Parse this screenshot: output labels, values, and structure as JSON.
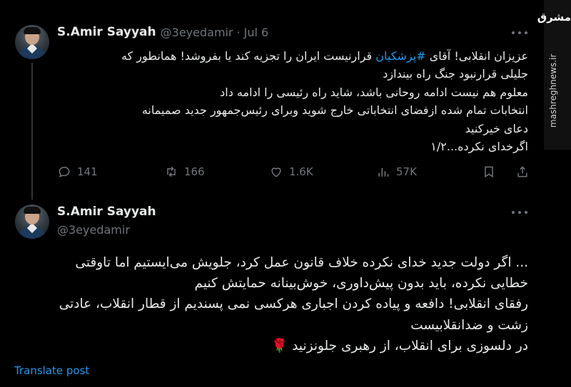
{
  "tweet1": {
    "name": "S.Amir Sayyah",
    "handle": "@3eyedamir",
    "dot": "·",
    "date": "Jul 6",
    "text_pre": "عزیزان انقلابی! آقای ",
    "hashtag": "#پزشکیان",
    "text_post": " قرارنیست ایران را تجزیه کند یا بفروشد! همانطور که",
    "lines": [
      "جلیلی قرارنبود جنگ راه بیندازد",
      "معلوم هم نیست ادامه روحانی باشد، شاید راه رئیسی را ادامه داد",
      "انتخابات تمام شده ازفضای انتخاباتی خارج شوید وبرای رئیس‌جمهور جدید صمیمانه",
      "دعای خیرکنید",
      "اگرخدای نکرده...۱/۲"
    ],
    "stats": {
      "replies": "141",
      "reposts": "166",
      "likes": "1.6K",
      "views": "57K"
    }
  },
  "tweet2": {
    "name": "S.Amir Sayyah",
    "handle": "@3eyedamir",
    "lines": [
      "... اگر دولت جدید خدای نکرده خلاف قانون عمل کرد، جلویش می‌ایستیم اما تاوقتی",
      "خطایی نکرده، باید بدون پیش‌داوری، خوش‌بینانه حمایتش کنیم",
      "رفقای انقلابی! دافعه و پیاده کردن اجباری هرکسی نمی پسندیم از قطار انقلاب، عادتی",
      "زشت و ضدانقلابیست",
      "در دلسوزی برای انقلاب، از رهبری جلونزنید 🌹"
    ],
    "translate": "Translate post"
  },
  "watermark": {
    "logo": "مشرق",
    "url": "mashreghnews.ir"
  }
}
